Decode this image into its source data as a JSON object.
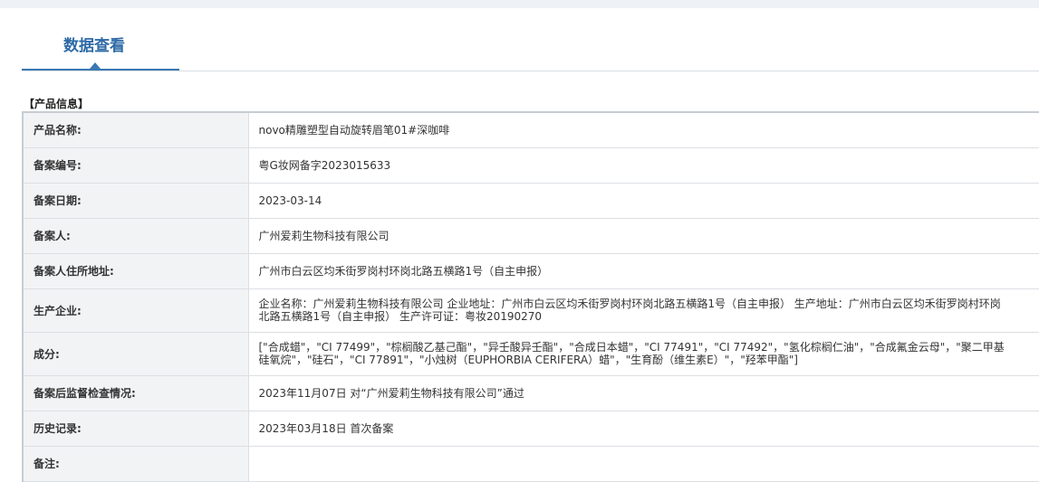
{
  "tabs": {
    "active_label": "数据查看"
  },
  "section": {
    "title": "【产品信息】"
  },
  "rows": [
    {
      "label": "产品名称:",
      "value": "novo精雕塑型自动旋转眉笔01#深咖啡"
    },
    {
      "label": "备案编号:",
      "value": "粤G妆网备字2023015633"
    },
    {
      "label": "备案日期:",
      "value": "2023-03-14"
    },
    {
      "label": "备案人:",
      "value": "广州爱莉生物科技有限公司"
    },
    {
      "label": "备案人住所地址:",
      "value": "广州市白云区均禾街罗岗村环岗北路五横路1号（自主申报）"
    },
    {
      "label": "生产企业:",
      "value": "企业名称：广州爱莉生物科技有限公司 企业地址：广州市白云区均禾街罗岗村环岗北路五横路1号（自主申报） 生产地址：广州市白云区均禾街罗岗村环岗北路五横路1号（自主申报） 生产许可证：粤妆20190270"
    },
    {
      "label": "成分:",
      "value": "[\"合成蜡\"，\"CI 77499\"，\"棕榈酸乙基己酯\"，\"异壬酸异壬酯\"，\"合成日本蜡\"，\"CI 77491\"，\"CI 77492\"，\"氢化棕榈仁油\"，\"合成氟金云母\"，\"聚二甲基硅氧烷\"，\"硅石\"，\"CI 77891\"，\"小烛树（EUPHORBIA CERIFERA）蜡\"，\"生育酚（维生素E）\"，\"羟苯甲酯\"]"
    },
    {
      "label": "备案后监督检查情况:",
      "value": "2023年11月07日 对“广州爱莉生物科技有限公司”通过"
    },
    {
      "label": "历史记录:",
      "value": "2023年03月18日 首次备案"
    },
    {
      "label": "备注:",
      "value": ""
    }
  ]
}
